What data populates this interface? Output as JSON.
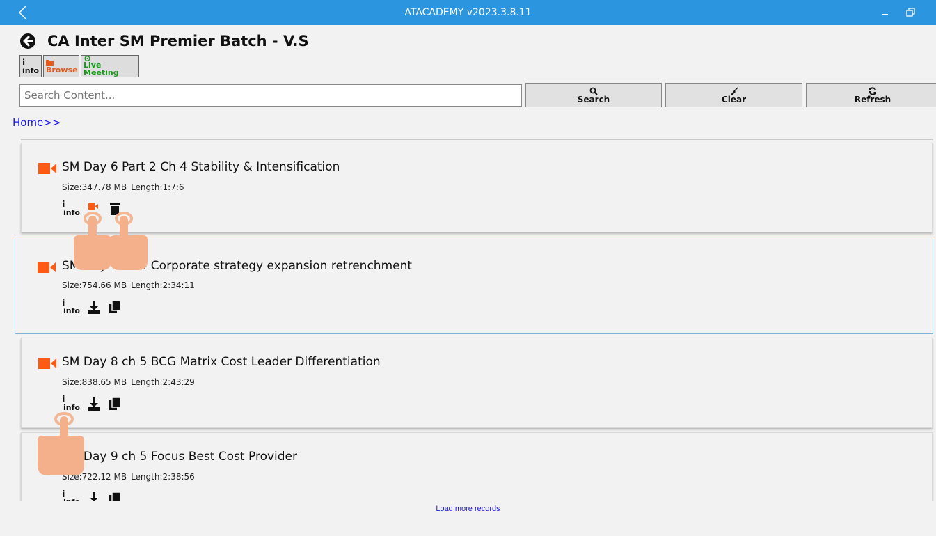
{
  "window": {
    "title": "ATACADEMY v2023.3.8.11",
    "back_icon": "chevron-left-icon",
    "minimize_icon": "minimize-icon",
    "restore_icon": "restore-icon",
    "accent": "#2b95e0"
  },
  "header": {
    "title": "CA Inter SM Premier Batch - V.S",
    "back_icon": "circle-arrow-left-icon"
  },
  "toolbar": {
    "info_label": "info",
    "browse_label": "Browse",
    "live_label": "Live Meeting"
  },
  "search": {
    "placeholder": "Search Content...",
    "search_label": "Search",
    "clear_label": "Clear",
    "refresh_label": "Refresh"
  },
  "breadcrumb": "Home>>",
  "items": [
    {
      "title": "SM Day 6 Part 2 Ch 4 Stability & Intensification",
      "size": "Size:347.78 MB",
      "length": "Length:1:7:6",
      "actions": [
        "info",
        "play",
        "delete"
      ]
    },
    {
      "title": "SM Day 7 ch 4 Corporate strategy expansion retrenchment",
      "size": "Size:754.66 MB",
      "length": "Length:2:34:11",
      "actions": [
        "info",
        "download",
        "copy"
      ]
    },
    {
      "title": "SM Day 8 ch 5 BCG Matrix Cost Leader Differentiation",
      "size": "Size:838.65 MB",
      "length": "Length:2:43:29",
      "actions": [
        "info",
        "download",
        "copy"
      ]
    },
    {
      "title": "SM Day 9 ch 5 Focus Best Cost Provider",
      "size": "Size:722.12 MB",
      "length": "Length:2:38:56",
      "actions": [
        "info",
        "download",
        "copy"
      ]
    }
  ],
  "info_action_label": "info",
  "load_more": "Load more records",
  "colors": {
    "video_icon": "#ff5a14",
    "browse": "#e85a1c",
    "live": "#1a9a1a",
    "link": "#1a1ae6",
    "hand": "#f4b08a"
  }
}
